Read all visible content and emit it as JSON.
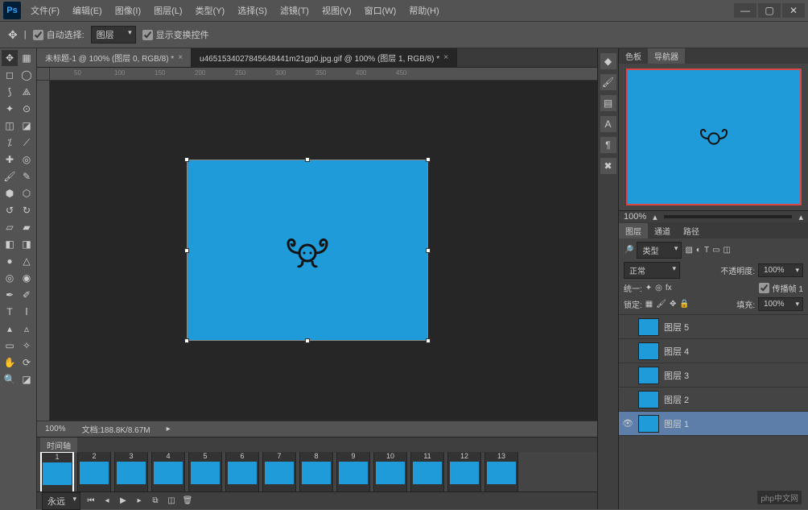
{
  "app": {
    "logo_text": "Ps"
  },
  "menu": {
    "file": "文件(F)",
    "edit": "编辑(E)",
    "image": "图像(I)",
    "layer": "图层(L)",
    "type": "类型(Y)",
    "select": "选择(S)",
    "filter": "滤镜(T)",
    "view": "视图(V)",
    "window": "窗口(W)",
    "help": "帮助(H)"
  },
  "options": {
    "auto_select_label": "自动选择:",
    "auto_select_target": "图层",
    "show_transform_label": "显示变换控件"
  },
  "tabs": {
    "t1": "未标题-1 @ 100% (图层 0, RGB/8) *",
    "t2": "u4651534027845648441m21gp0.jpg.gif @ 100% (图层 1, RGB/8) *"
  },
  "status": {
    "zoom": "100%",
    "doc_info": "文档:188.8K/8.67M"
  },
  "timeline": {
    "title": "时间轴",
    "play_mode": "永远",
    "frames": [
      "1",
      "2",
      "3",
      "4",
      "5",
      "6",
      "7",
      "8",
      "9",
      "10",
      "11",
      "12",
      "13"
    ]
  },
  "panel_nav": {
    "tab_swatches": "色板",
    "tab_navigator": "导航器",
    "zoom_value": "100%"
  },
  "panel_layers": {
    "tab_layers": "图层",
    "tab_channels": "通道",
    "tab_paths": "路径",
    "filter_kind": "类型",
    "blend_mode": "正常",
    "opacity_label": "不透明度:",
    "opacity_value": "100%",
    "unified_label": "统一:",
    "propagate_label": "传播帧 1",
    "lock_label": "锁定:",
    "fill_label": "填充:",
    "fill_value": "100%",
    "layers": [
      {
        "name": "图层 5",
        "visible": false
      },
      {
        "name": "图层 4",
        "visible": false
      },
      {
        "name": "图层 3",
        "visible": false
      },
      {
        "name": "图层 2",
        "visible": false
      },
      {
        "name": "图层 1",
        "visible": true,
        "active": true
      }
    ]
  },
  "watermark": "php中文网",
  "colors": {
    "canvas_blue": "#1e9bd8",
    "selection_red": "#d44"
  }
}
